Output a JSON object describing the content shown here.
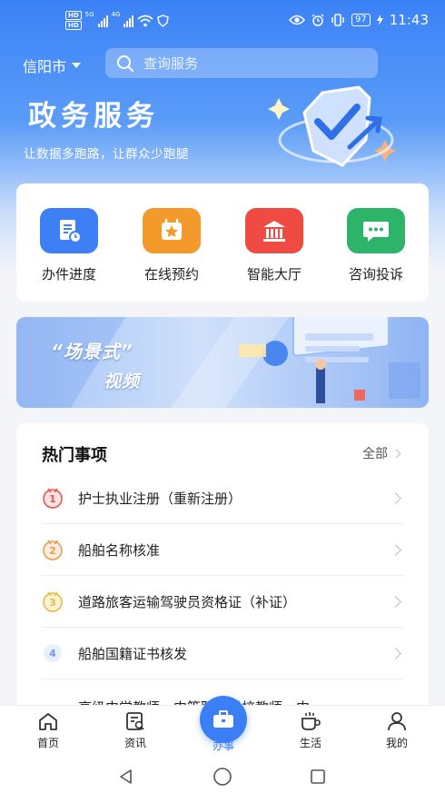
{
  "status_bar": {
    "hd1": "HD",
    "hd2": "HD",
    "net1": "5G",
    "net2": "4G",
    "battery": "97",
    "time": "11:43"
  },
  "header": {
    "city": "信阳市",
    "search_placeholder": "查询服务",
    "title": "政务服务",
    "subtitle": "让数据多跑路，让群众少跑腿"
  },
  "quick_actions": [
    {
      "label": "办件进度",
      "color": "#3d7ff5",
      "icon": "progress-doc-icon"
    },
    {
      "label": "在线预约",
      "color": "#f39a2b",
      "icon": "star-calendar-icon"
    },
    {
      "label": "智能大厅",
      "color": "#ef4b43",
      "icon": "hall-building-icon"
    },
    {
      "label": "咨询投诉",
      "color": "#2db36a",
      "icon": "chat-bubble-icon"
    }
  ],
  "video_banner": {
    "line1": "“场景式”",
    "line2": "视频"
  },
  "hot": {
    "title": "热门事项",
    "all_label": "全部",
    "items": [
      {
        "rank": "1",
        "text": "护士执业注册（重新注册）"
      },
      {
        "rank": "2",
        "text": "船舶名称核准"
      },
      {
        "rank": "3",
        "text": "道路旅客运输驾驶员资格证（补证）"
      },
      {
        "rank": "4",
        "text": "船舶国籍证书核发"
      },
      {
        "rank": "",
        "text": "高级中学教师、中等职业学校教师、中"
      }
    ]
  },
  "tabs": [
    {
      "label": "首页",
      "icon": "home-icon"
    },
    {
      "label": "资讯",
      "icon": "news-icon"
    },
    {
      "label": "办事",
      "icon": "briefcase-icon"
    },
    {
      "label": "生活",
      "icon": "coffee-icon"
    },
    {
      "label": "我的",
      "icon": "person-icon"
    }
  ],
  "colors": {
    "primary": "#3a7ff6",
    "rank1": "#e8534a",
    "rank2": "#e89a4a",
    "rank3": "#e8b93a",
    "rank4": "#6a9cf0"
  }
}
